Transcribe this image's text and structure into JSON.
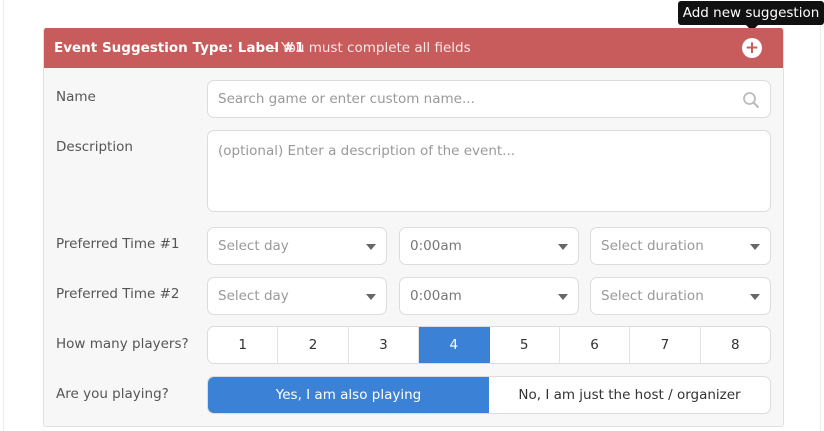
{
  "tooltip": {
    "text": "Add new suggestion"
  },
  "header": {
    "title": "Event Suggestion Type: Label #1",
    "message": " - You must complete all fields",
    "add_icon": "plus-circle-icon"
  },
  "colors": {
    "header_bg": "#c85c5c",
    "accent": "#3b82d6"
  },
  "form": {
    "name": {
      "label": "Name",
      "placeholder": "Search game or enter custom name...",
      "icon": "search-icon"
    },
    "description": {
      "label": "Description",
      "placeholder": "(optional) Enter a description of the event..."
    },
    "time1": {
      "label": "Preferred Time #1",
      "day": "Select day",
      "time": "0:00am",
      "duration": "Select duration"
    },
    "time2": {
      "label": "Preferred Time #2",
      "day": "Select day",
      "time": "0:00am",
      "duration": "Select duration"
    },
    "players": {
      "label": "How many players?",
      "options": [
        "1",
        "2",
        "3",
        "4",
        "5",
        "6",
        "7",
        "8"
      ],
      "selected": "4"
    },
    "playing": {
      "label": "Are you playing?",
      "yes": "Yes, I am also playing",
      "no": "No, I am just the host / organizer",
      "selected": "yes"
    }
  }
}
